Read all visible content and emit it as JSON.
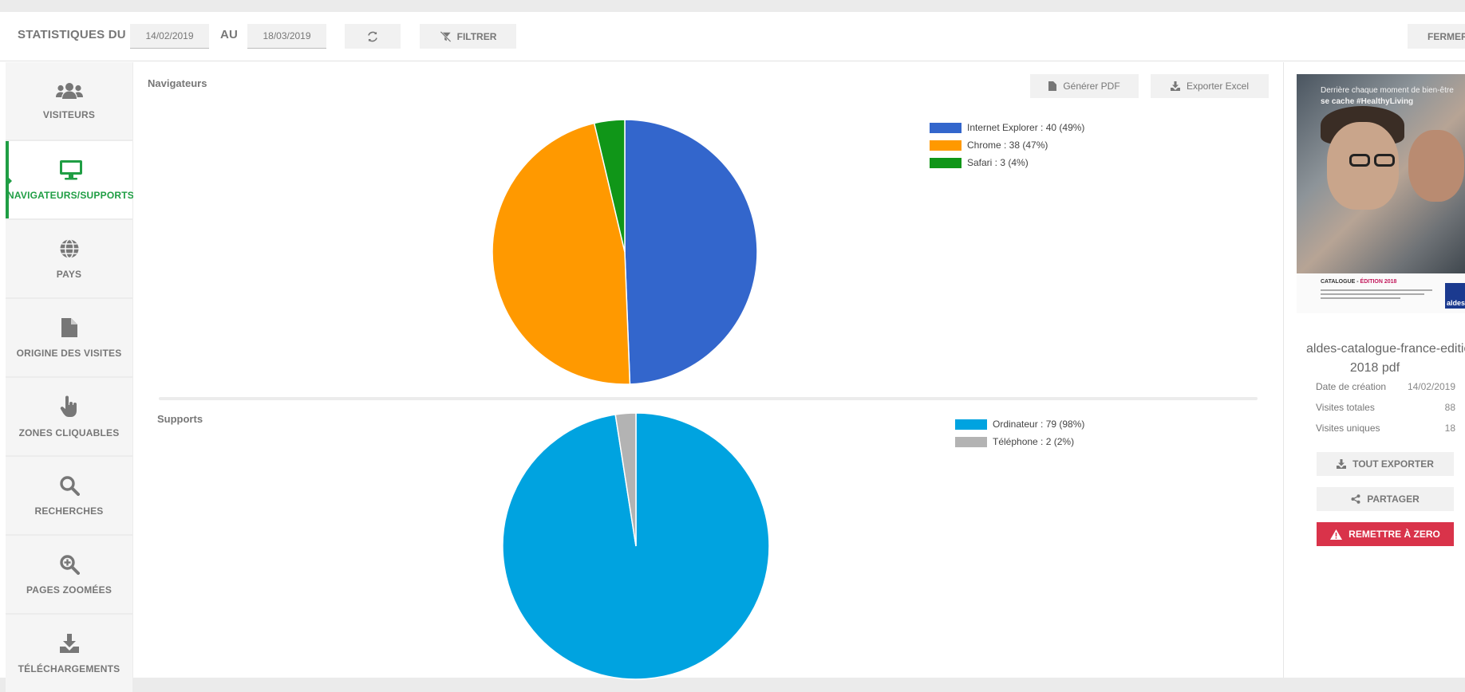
{
  "header": {
    "stats_label": "STATISTIQUES DU",
    "date_from": "14/02/2019",
    "to_label": "AU",
    "date_to": "18/03/2019",
    "filter_label": "FILTRER",
    "close_label": "FERMER"
  },
  "sidebar": {
    "items": [
      {
        "label": "VISITEURS",
        "icon": "users-icon"
      },
      {
        "label": "NAVIGATEURS/SUPPORTS",
        "icon": "desktop-icon"
      },
      {
        "label": "PAYS",
        "icon": "globe-icon"
      },
      {
        "label": "ORIGINE DES VISITES",
        "icon": "file-icon"
      },
      {
        "label": "ZONES CLIQUABLES",
        "icon": "hand-pointer-icon"
      },
      {
        "label": "RECHERCHES",
        "icon": "search-icon"
      },
      {
        "label": "PAGES ZOOMÉES",
        "icon": "zoom-in-icon"
      },
      {
        "label": "TÉLÉCHARGEMENTS",
        "icon": "download-icon"
      }
    ],
    "active_index": 1
  },
  "main": {
    "browsers_title": "Navigateurs",
    "supports_title": "Supports",
    "pdf_label": "Générer PDF",
    "excel_label": "Exporter Excel"
  },
  "chart_data": [
    {
      "type": "pie",
      "title": "Navigateurs",
      "categories": [
        "Internet Explorer",
        "Chrome",
        "Safari"
      ],
      "values": [
        40,
        38,
        3
      ],
      "colors": [
        "#3366cc",
        "#ff9900",
        "#109618"
      ],
      "legend_labels": [
        "Internet Explorer : 40 (49%)",
        "Chrome : 38 (47%)",
        "Safari : 3 (4%)"
      ],
      "legend": "right"
    },
    {
      "type": "pie",
      "title": "Supports",
      "categories": [
        "Ordinateur",
        "Téléphone"
      ],
      "values": [
        79,
        2
      ],
      "colors": [
        "#00a3e0",
        "#b3b3b3"
      ],
      "legend_labels": [
        "Ordinateur : 79 (98%)",
        "Téléphone : 2 (2%)"
      ],
      "legend": "right"
    }
  ],
  "document": {
    "tagline_1": "Derrière chaque moment de bien-être",
    "tagline_2": "se cache #HealthyLiving",
    "catalogue_prefix": "CATALOGUE",
    "catalogue_edition": "ÉDITION 2018",
    "brand": "aldes",
    "title_line1": "aldes-catalogue-france-edition",
    "title_line2": "2018 pdf",
    "meta": [
      {
        "label": "Date de création",
        "value": "14/02/2019"
      },
      {
        "label": "Visites totales",
        "value": "88"
      },
      {
        "label": "Visites uniques",
        "value": "18"
      }
    ],
    "export_all_label": "TOUT EXPORTER",
    "share_label": "PARTAGER",
    "reset_label": "REMETTRE À ZERO"
  }
}
